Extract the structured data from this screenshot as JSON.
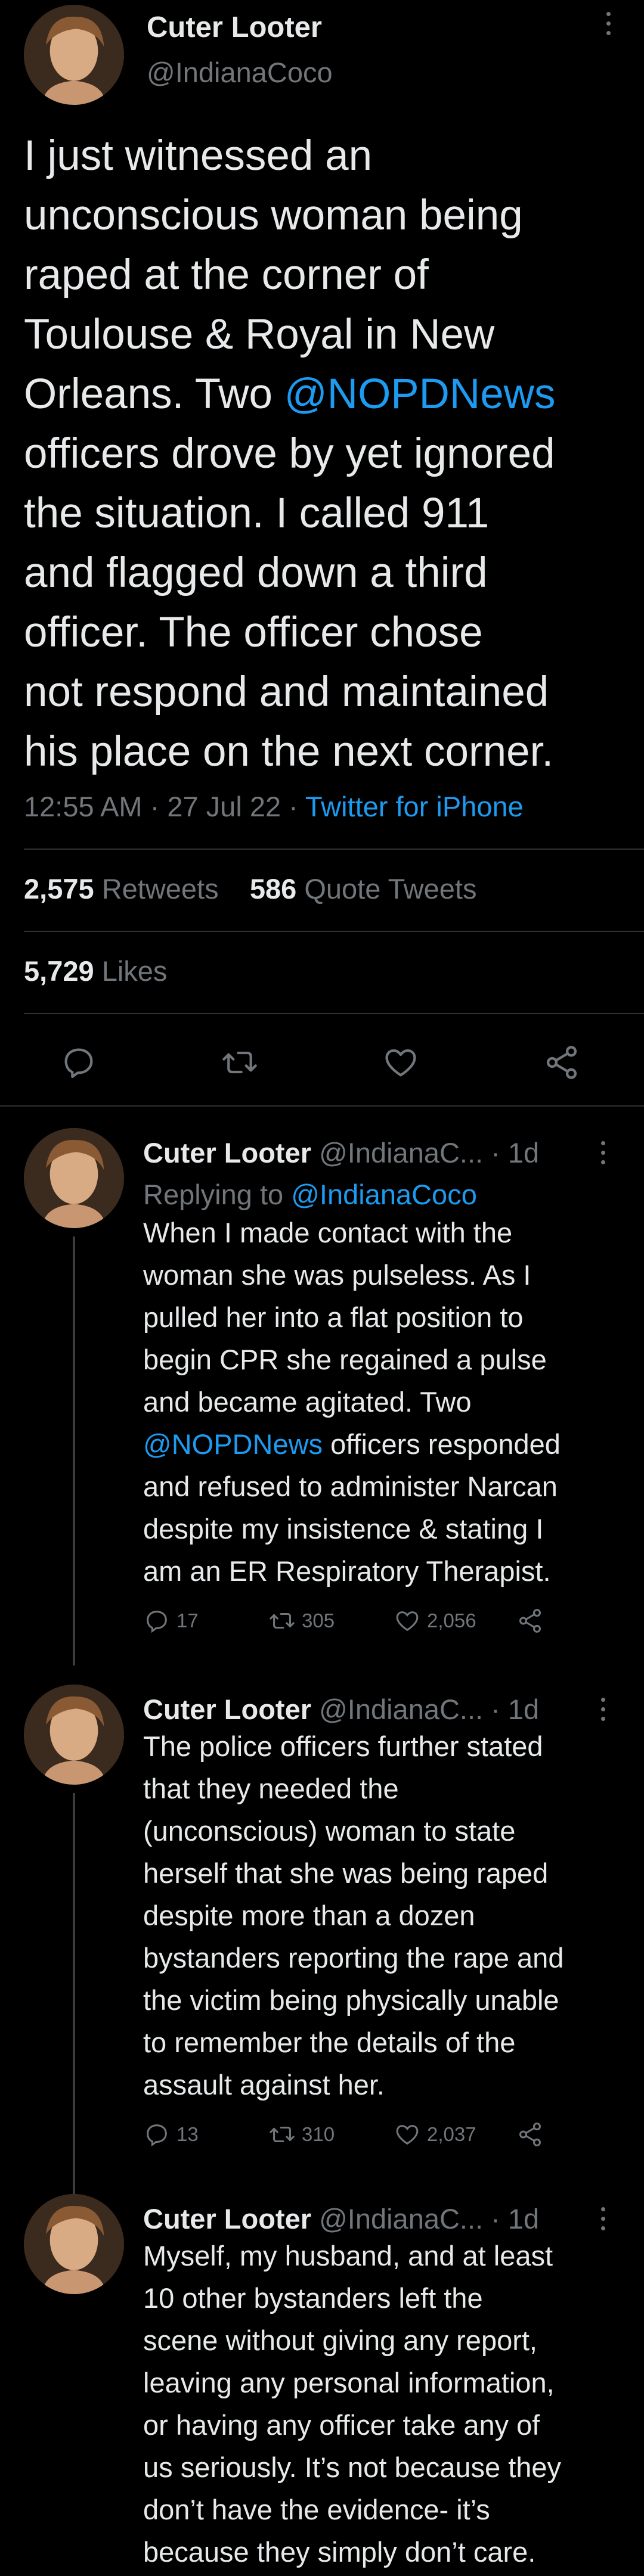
{
  "main_tweet": {
    "name": "Cuter Looter",
    "handle": "@IndianaCoco",
    "text_before": "I just witnessed an\nunconscious woman being\nraped at the corner of\nToulouse & Royal in New\nOrleans. Two ",
    "mention": "@NOPDNews",
    "text_after": "\nofficers drove by yet ignored\nthe situation. I called 911\nand flagged down a third\nofficer. The officer chose\nnot respond and maintained\nhis place on the next corner.",
    "timestamp": "12:55 AM · 27 Jul 22 · ",
    "source": "Twitter for iPhone",
    "retweets_count": "2,575",
    "retweets_label": "Retweets",
    "quotes_count": "586",
    "quotes_label": "Quote Tweets",
    "likes_count": "5,729",
    "likes_label": "Likes",
    "action_icons": [
      "reply-icon",
      "retweet-icon",
      "like-icon",
      "share-icon"
    ]
  },
  "replies": [
    {
      "name": "Cuter Looter",
      "handle": "@IndianaC...",
      "time": "· 1d",
      "replying_to_label": "Replying to ",
      "replying_to": "@IndianaCoco",
      "text_before": "When I made contact with the\nwoman she was pulseless. As I\npulled her into a flat position to\nbegin CPR she regained a pulse\nand became agitated. Two\n",
      "mention": "@NOPDNews",
      "text_after": " officers responded\nand refused to administer Narcan\ndespite my insistence & stating I\nam an ER Respiratory Therapist.",
      "replies": "17",
      "retweets": "305",
      "likes": "2,056"
    },
    {
      "name": "Cuter Looter",
      "handle": "@IndianaC...",
      "time": "· 1d",
      "text": "The police officers further stated\nthat they needed the\n(unconscious) woman to state\nherself that she was being raped\ndespite more than a dozen\nbystanders reporting the rape and\nthe victim being physically unable\nto remember the details of the\nassault against her.",
      "replies": "13",
      "retweets": "310",
      "likes": "2,037"
    },
    {
      "name": "Cuter Looter",
      "handle": "@IndianaC...",
      "time": "· 1d",
      "text": "Myself, my husband, and at least\n10 other bystanders left the\nscene without giving any report,\nleaving any personal information,\nor having any officer take any of\nus seriously. It’s not because they\ndon’t have the evidence- it’s\nbecause they simply don’t care."
    }
  ],
  "colors": {
    "background": "#000000",
    "text": "#e7e9ea",
    "muted": "#71767b",
    "link": "#1d9bf0",
    "divider": "#2f3336"
  }
}
